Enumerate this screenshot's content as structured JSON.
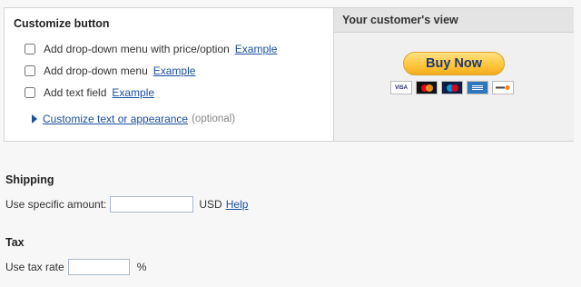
{
  "customize": {
    "title": "Customize button",
    "options": [
      {
        "label": "Add drop-down menu with price/option",
        "link": "Example"
      },
      {
        "label": "Add drop-down menu",
        "link": "Example"
      },
      {
        "label": "Add text field",
        "link": "Example"
      }
    ],
    "customize_link": "Customize text or appearance",
    "optional_note": "(optional)"
  },
  "preview": {
    "title": "Your customer's view",
    "button_label": "Buy Now",
    "cards": [
      {
        "name": "visa-card-icon",
        "text": "VISA"
      },
      {
        "name": "mastercard-icon",
        "text": ""
      },
      {
        "name": "maestro-card-icon",
        "text": ""
      },
      {
        "name": "amex-card-icon",
        "text": "AMERICAN EXPRESS"
      },
      {
        "name": "discover-card-icon",
        "text": "DISCOVER"
      }
    ],
    "button_color": "#ffc439",
    "link_color": "#1a4f9e"
  },
  "shipping": {
    "title": "Shipping",
    "label": "Use specific amount:",
    "value": "",
    "currency": "USD",
    "help": "Help"
  },
  "tax": {
    "title": "Tax",
    "label": "Use tax rate",
    "value": "",
    "unit": "%"
  }
}
